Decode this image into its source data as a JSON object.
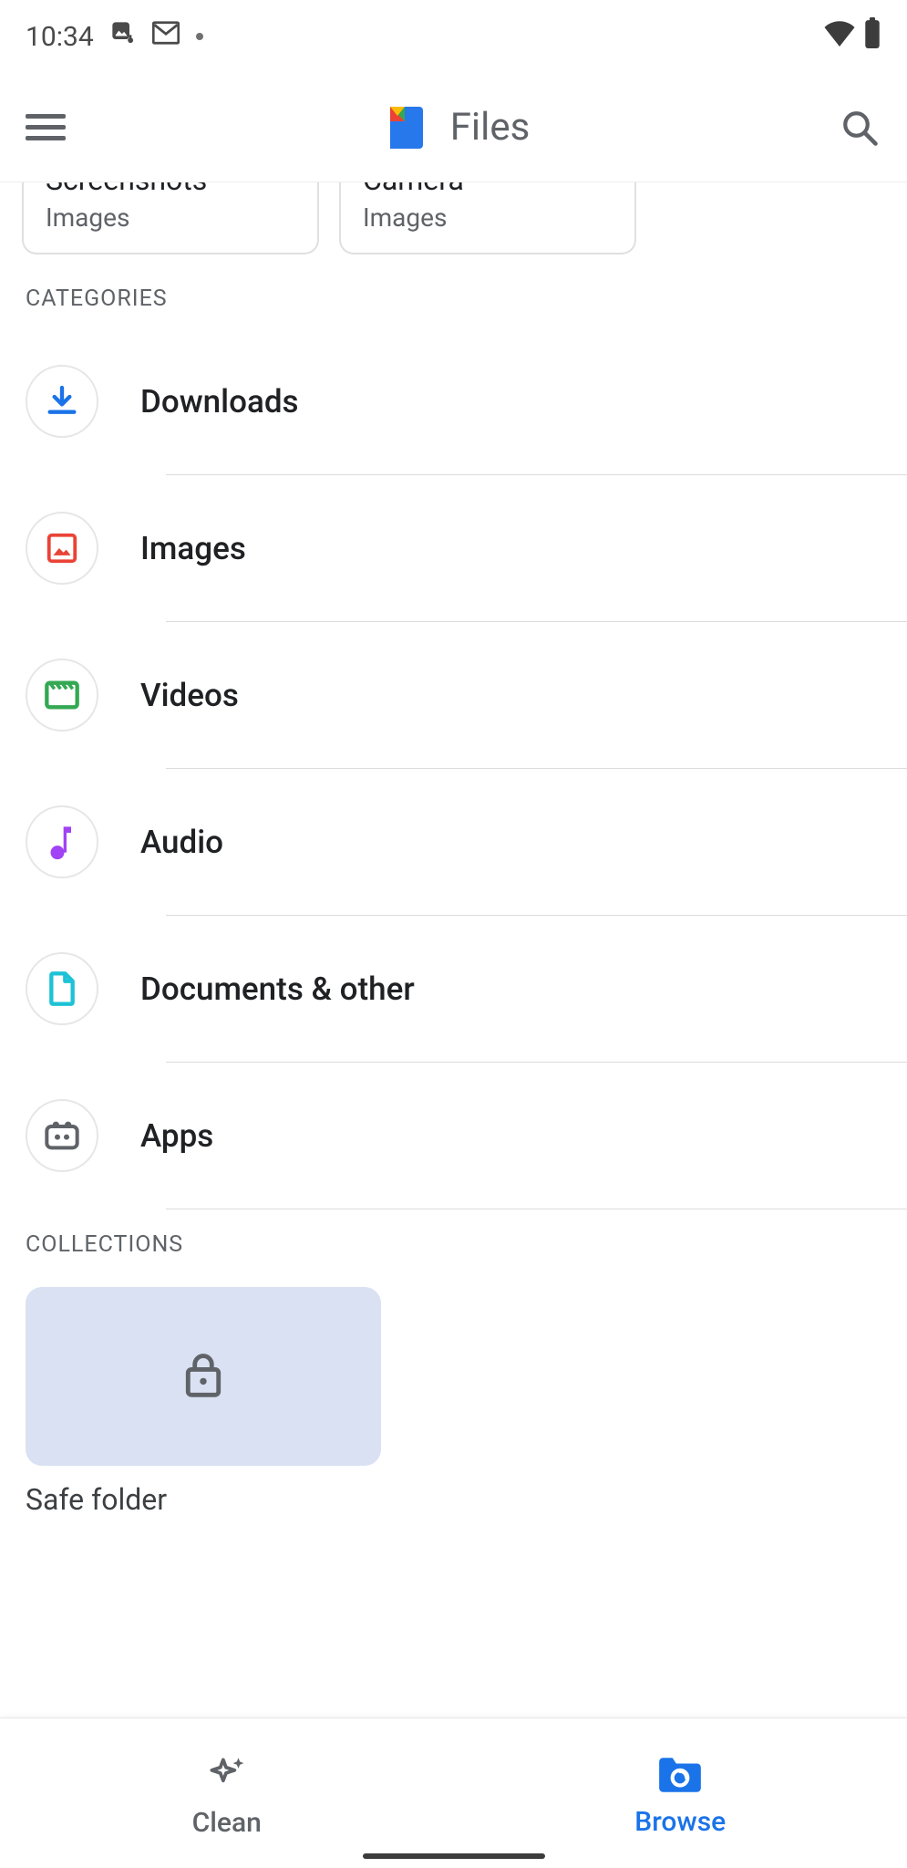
{
  "status": {
    "time": "10:34"
  },
  "app": {
    "title": "Files"
  },
  "recent": [
    {
      "title": "Screenshots",
      "subtitle": "Images"
    },
    {
      "title": "Camera",
      "subtitle": "Images"
    }
  ],
  "sections": {
    "categories": "Categories",
    "collections": "Collections"
  },
  "categories": [
    {
      "id": "downloads",
      "label": "Downloads",
      "icon": "download-icon",
      "color": "#1a73e8"
    },
    {
      "id": "images",
      "label": "Images",
      "icon": "image-icon",
      "color": "#ea4335"
    },
    {
      "id": "videos",
      "label": "Videos",
      "icon": "video-icon",
      "color": "#34a853"
    },
    {
      "id": "audio",
      "label": "Audio",
      "icon": "audio-icon",
      "color": "#a142f4"
    },
    {
      "id": "documents",
      "label": "Documents & other",
      "icon": "document-icon",
      "color": "#1ec2d6"
    },
    {
      "id": "apps",
      "label": "Apps",
      "icon": "apps-icon",
      "color": "#5f6368"
    }
  ],
  "collections": [
    {
      "id": "safe-folder",
      "label": "Safe folder",
      "icon": "lock-icon"
    }
  ],
  "nav": {
    "items": [
      {
        "id": "clean",
        "label": "Clean",
        "icon": "sparkle-icon",
        "active": false
      },
      {
        "id": "browse",
        "label": "Browse",
        "icon": "browse-folder-icon",
        "active": true
      }
    ]
  }
}
